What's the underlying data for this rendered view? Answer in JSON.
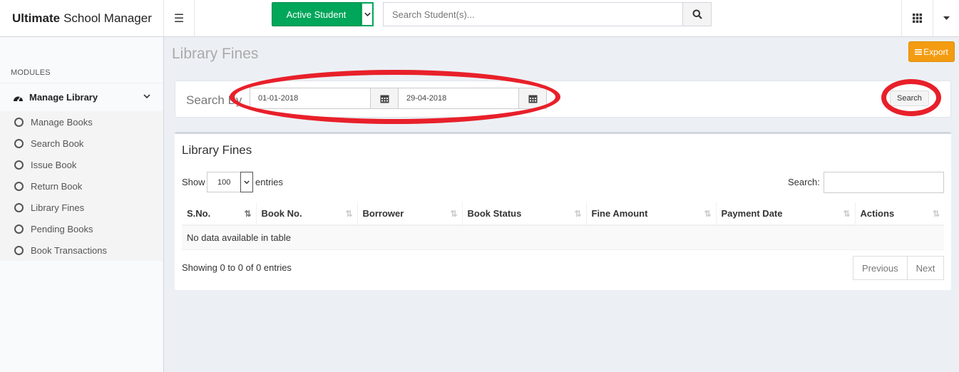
{
  "header": {
    "app_bold": "Ultimate",
    "app_rest": "School Manager",
    "student_filter_label": "Active Student",
    "search_placeholder": "Search Student(s)..."
  },
  "sidebar": {
    "section_label": "MODULES",
    "group_label": "Manage Library",
    "items": [
      {
        "label": "Manage Books"
      },
      {
        "label": "Search Book"
      },
      {
        "label": "Issue Book"
      },
      {
        "label": "Return Book"
      },
      {
        "label": "Library Fines"
      },
      {
        "label": "Pending Books"
      },
      {
        "label": "Book Transactions"
      }
    ]
  },
  "page": {
    "title": "Library Fines",
    "export_label": "Export"
  },
  "filter": {
    "search_by_label": "Search By",
    "from_date": "01-01-2018",
    "to_date": "29-04-2018",
    "search_button": "Search"
  },
  "table_box": {
    "title": "Library Fines",
    "show_label": "Show",
    "page_length": "100",
    "entries_label": "entries",
    "filter_label": "Search:",
    "columns": [
      "S.No.",
      "Book No.",
      "Borrower",
      "Book Status",
      "Fine Amount",
      "Payment Date",
      "Actions"
    ],
    "empty_message": "No data available in table",
    "info": "Showing 0 to 0 of 0 entries",
    "prev_label": "Previous",
    "next_label": "Next"
  },
  "colors": {
    "success": "#00a65a",
    "warning": "#f39c12",
    "annotation": "#e8202a"
  }
}
